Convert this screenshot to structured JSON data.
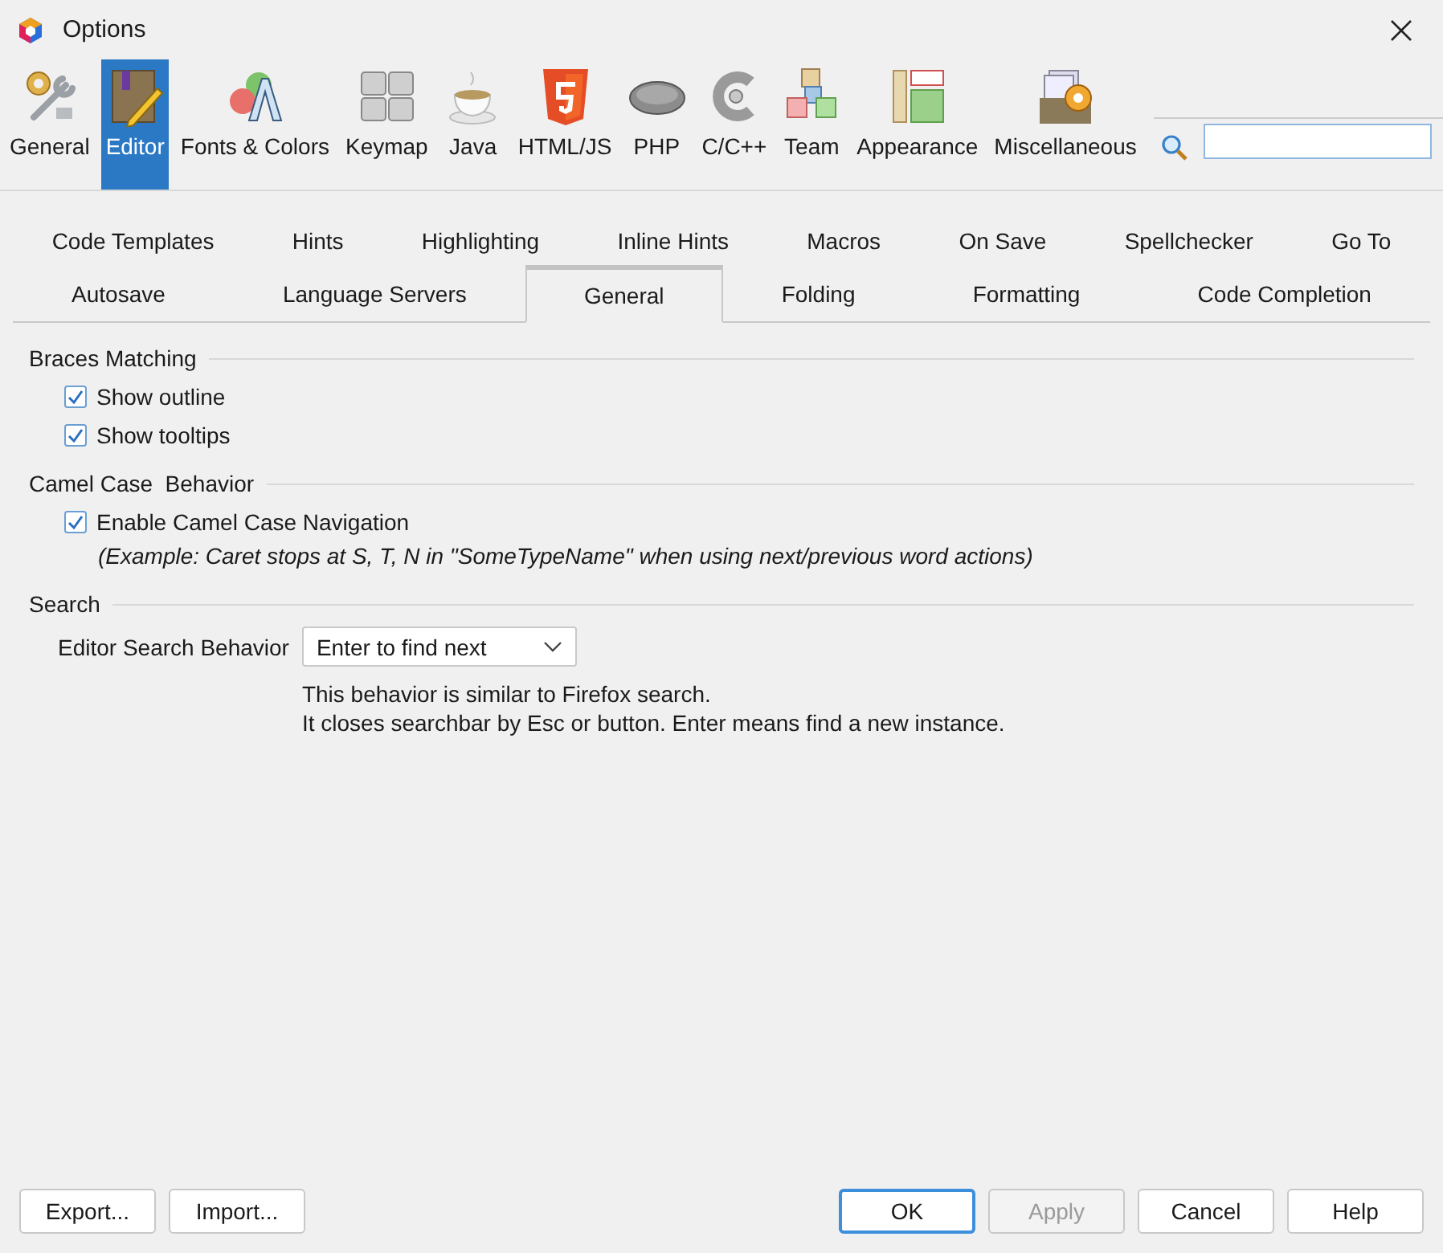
{
  "window": {
    "title": "Options"
  },
  "categories": [
    {
      "label": "General",
      "selected": false
    },
    {
      "label": "Editor",
      "selected": true
    },
    {
      "label": "Fonts & Colors",
      "selected": false
    },
    {
      "label": "Keymap",
      "selected": false
    },
    {
      "label": "Java",
      "selected": false
    },
    {
      "label": "HTML/JS",
      "selected": false
    },
    {
      "label": "PHP",
      "selected": false
    },
    {
      "label": "C/C++",
      "selected": false
    },
    {
      "label": "Team",
      "selected": false
    },
    {
      "label": "Appearance",
      "selected": false
    },
    {
      "label": "Miscellaneous",
      "selected": false
    }
  ],
  "tab_rows": [
    [
      {
        "label": "Code Templates",
        "selected": false
      },
      {
        "label": "Hints",
        "selected": false
      },
      {
        "label": "Highlighting",
        "selected": false
      },
      {
        "label": "Inline Hints",
        "selected": false
      },
      {
        "label": "Macros",
        "selected": false
      },
      {
        "label": "On Save",
        "selected": false
      },
      {
        "label": "Spellchecker",
        "selected": false
      },
      {
        "label": "Go To",
        "selected": false
      }
    ],
    [
      {
        "label": "Autosave",
        "selected": false
      },
      {
        "label": "Language Servers",
        "selected": false
      },
      {
        "label": "General",
        "selected": true
      },
      {
        "label": "Folding",
        "selected": false
      },
      {
        "label": "Formatting",
        "selected": false
      },
      {
        "label": "Code Completion",
        "selected": false
      }
    ]
  ],
  "sections": [
    {
      "title": "Braces Matching",
      "items": [
        {
          "kind": "checkbox",
          "label": "Show outline",
          "checked": true
        },
        {
          "kind": "checkbox",
          "label": "Show tooltips",
          "checked": true
        }
      ]
    },
    {
      "title": "Camel Case  Behavior",
      "items": [
        {
          "kind": "checkbox",
          "label": "Enable Camel Case Navigation",
          "checked": true
        },
        {
          "kind": "note",
          "text": "(Example: Caret stops at S, T, N in \"SomeTypeName\" when using next/previous word actions)"
        }
      ]
    },
    {
      "title": "Search",
      "items": [
        {
          "kind": "select",
          "label": "Editor Search Behavior",
          "value": "Enter to find next",
          "description": [
            "This behavior is similar to Firefox search.",
            "It closes searchbar by Esc or button. Enter means find a new instance."
          ]
        }
      ]
    }
  ],
  "buttons_left": [
    {
      "label": "Export...",
      "default": false,
      "disabled": false
    },
    {
      "label": "Import...",
      "default": false,
      "disabled": false
    }
  ],
  "buttons_right": [
    {
      "label": "OK",
      "default": true,
      "disabled": false
    },
    {
      "label": "Apply",
      "default": false,
      "disabled": true
    },
    {
      "label": "Cancel",
      "default": false,
      "disabled": false
    },
    {
      "label": "Help",
      "default": false,
      "disabled": false
    }
  ]
}
